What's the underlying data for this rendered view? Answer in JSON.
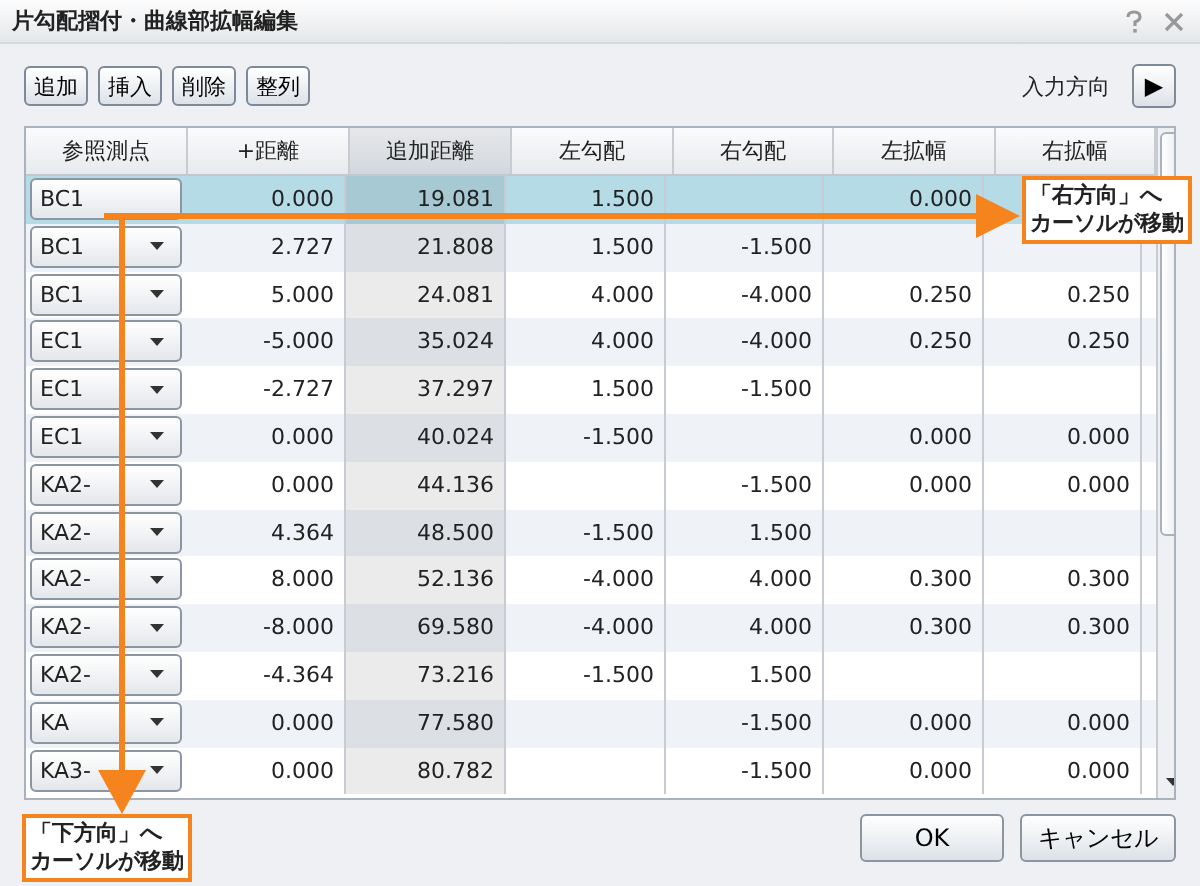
{
  "window": {
    "title": "片勾配摺付・曲線部拡幅編集"
  },
  "toolbar": {
    "buttons": [
      "追加",
      "挿入",
      "削除",
      "整列"
    ],
    "direction_label": "入力方向",
    "direction_button": "▶"
  },
  "table": {
    "columns": [
      {
        "label": "参照測点",
        "shaded": false
      },
      {
        "label": "+距離",
        "shaded": false
      },
      {
        "label": "追加距離",
        "shaded": true
      },
      {
        "label": "左勾配",
        "shaded": false
      },
      {
        "label": "右勾配",
        "shaded": false
      },
      {
        "label": "左拡幅",
        "shaded": false
      },
      {
        "label": "右拡幅",
        "shaded": false
      }
    ],
    "rows": [
      {
        "selected": true,
        "cells": [
          "BC1",
          "0.000",
          "19.081",
          "1.500",
          "",
          "0.000",
          ""
        ]
      },
      {
        "selected": false,
        "cells": [
          "BC1",
          "2.727",
          "21.808",
          "1.500",
          "-1.500",
          "",
          ""
        ]
      },
      {
        "selected": false,
        "cells": [
          "BC1",
          "5.000",
          "24.081",
          "4.000",
          "-4.000",
          "0.250",
          "0.250"
        ]
      },
      {
        "selected": false,
        "cells": [
          "EC1",
          "-5.000",
          "35.024",
          "4.000",
          "-4.000",
          "0.250",
          "0.250"
        ]
      },
      {
        "selected": false,
        "cells": [
          "EC1",
          "-2.727",
          "37.297",
          "1.500",
          "-1.500",
          "",
          ""
        ]
      },
      {
        "selected": false,
        "cells": [
          "EC1",
          "0.000",
          "40.024",
          "-1.500",
          "",
          "0.000",
          "0.000"
        ]
      },
      {
        "selected": false,
        "cells": [
          "KA2-",
          "0.000",
          "44.136",
          "",
          "-1.500",
          "0.000",
          "0.000"
        ]
      },
      {
        "selected": false,
        "cells": [
          "KA2-",
          "4.364",
          "48.500",
          "-1.500",
          "1.500",
          "",
          ""
        ]
      },
      {
        "selected": false,
        "cells": [
          "KA2-",
          "8.000",
          "52.136",
          "-4.000",
          "4.000",
          "0.300",
          "0.300"
        ]
      },
      {
        "selected": false,
        "cells": [
          "KA2-",
          "-8.000",
          "69.580",
          "-4.000",
          "4.000",
          "0.300",
          "0.300"
        ]
      },
      {
        "selected": false,
        "cells": [
          "KA2-",
          "-4.364",
          "73.216",
          "-1.500",
          "1.500",
          "",
          ""
        ]
      },
      {
        "selected": false,
        "cells": [
          "KA",
          "0.000",
          "77.580",
          "",
          "-1.500",
          "0.000",
          "0.000"
        ]
      },
      {
        "selected": false,
        "cells": [
          "KA3-",
          "0.000",
          "80.782",
          "",
          "-1.500",
          "0.000",
          "0.000"
        ]
      }
    ]
  },
  "callouts": [
    {
      "kind": "right",
      "lines": [
        "「右方向」へ",
        "カーソルが移動"
      ]
    },
    {
      "kind": "down",
      "lines": [
        "「下方向」へ",
        "カーソルが移動"
      ]
    }
  ],
  "buttons": [
    "OK",
    "キャンセル"
  ]
}
